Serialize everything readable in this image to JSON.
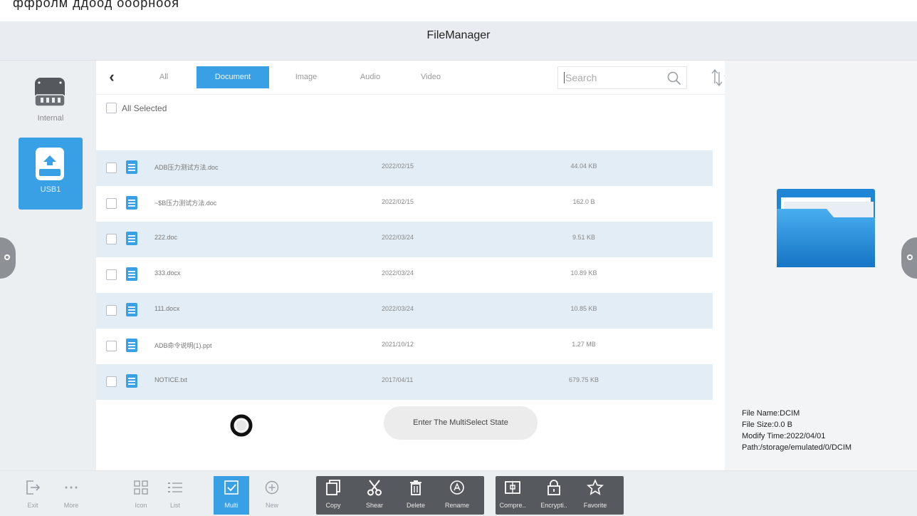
{
  "window_title": "FileManager",
  "top_partial_text": "ффролм ддоод ооорнооя",
  "drives": [
    {
      "label": "Internal",
      "selected": false
    },
    {
      "label": "USB1",
      "selected": true
    }
  ],
  "tabs": [
    {
      "label": "All",
      "active": false
    },
    {
      "label": "Document",
      "active": true
    },
    {
      "label": "Image",
      "active": false
    },
    {
      "label": "Audio",
      "active": false
    },
    {
      "label": "Video",
      "active": false
    }
  ],
  "search": {
    "placeholder": "Search"
  },
  "select_all_label": "All Selected",
  "files": [
    {
      "name": "ADB压力测试方法.doc",
      "date": "2022/02/15",
      "size": "44.04 KB"
    },
    {
      "name": "~$B压力测试方法.doc",
      "date": "2022/02/15",
      "size": "162.0 B"
    },
    {
      "name": "222.doc",
      "date": "2022/03/24",
      "size": "9.51 KB"
    },
    {
      "name": "333.docx",
      "date": "2022/03/24",
      "size": "10.89 KB"
    },
    {
      "name": "111.docx",
      "date": "2022/03/24",
      "size": "10.85 KB"
    },
    {
      "name": "ADB命令说明(1).ppt",
      "date": "2021/10/12",
      "size": "1.27 MB"
    },
    {
      "name": "NOTICE.txt",
      "date": "2017/04/11",
      "size": "679.75 KB"
    }
  ],
  "toast": "Enter The MultiSelect State",
  "info": {
    "file_name": "File Name:DCIM",
    "file_size": "File Size:0.0 B",
    "modify_time": "Modify Time:2022/04/01",
    "path": "Path:/storage/emulated/0/DCIM"
  },
  "toolbar": {
    "exit": "Exit",
    "more": "More",
    "icon": "Icon",
    "list": "List",
    "multi": "Multi",
    "new": "New",
    "copy": "Copy",
    "shear": "Shear",
    "delete": "Delete",
    "rename": "Rename",
    "compress": "Compre..",
    "encrypt": "Encrypti..",
    "favorite": "Favorite"
  },
  "colors": {
    "accent": "#3aa0e6",
    "row_alt": "#e3edf5",
    "dark_group": "#56595d"
  }
}
